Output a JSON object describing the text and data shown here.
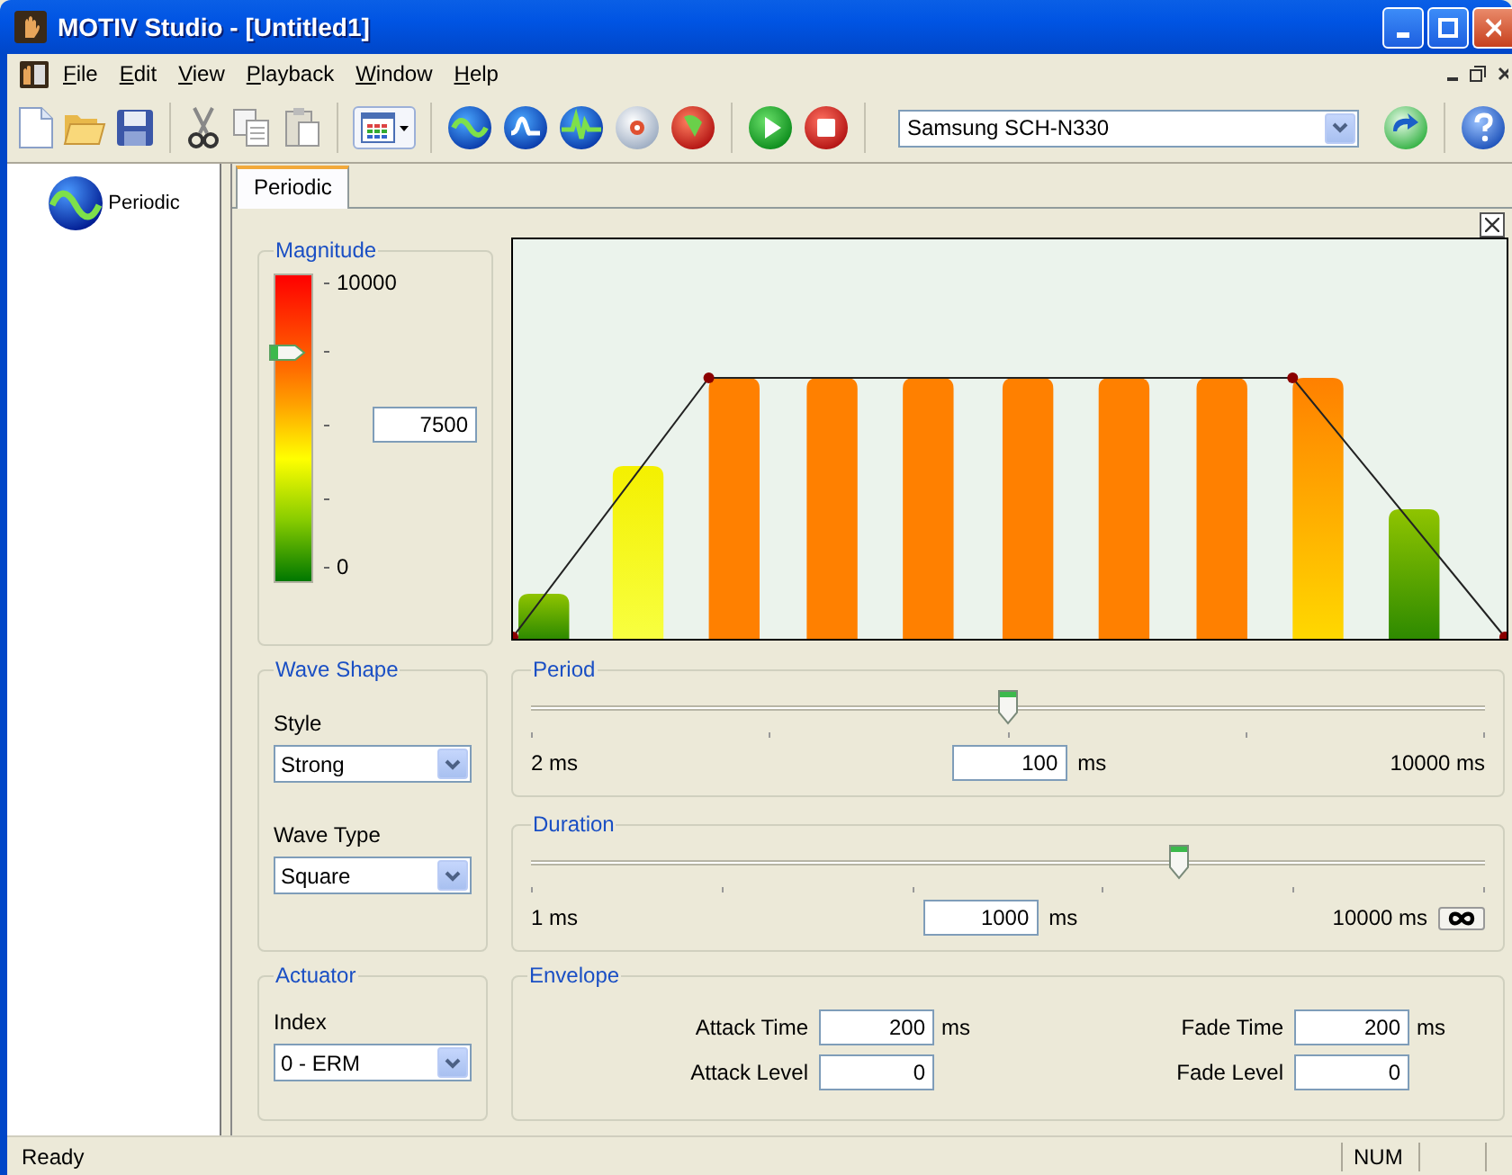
{
  "window": {
    "title": "MOTIV Studio - [Untitled1]"
  },
  "menu": [
    {
      "label": "File"
    },
    {
      "label": "Edit"
    },
    {
      "label": "View"
    },
    {
      "label": "Playback"
    },
    {
      "label": "Window"
    },
    {
      "label": "Help"
    }
  ],
  "toolbar": {
    "device": "Samsung SCH-N330"
  },
  "sidebar": {
    "items": [
      {
        "label": "Periodic"
      }
    ]
  },
  "tabs": [
    {
      "label": "Periodic",
      "selected": true
    }
  ],
  "magnitude": {
    "title": "Magnitude",
    "max_label": "10000",
    "min_label": "0",
    "level": 0.75,
    "value": "7500"
  },
  "wave_shape": {
    "title": "Wave Shape",
    "style_label": "Style",
    "style_value": "Strong",
    "type_label": "Wave Type",
    "type_value": "Square"
  },
  "actuator": {
    "title": "Actuator",
    "index_label": "Index",
    "index_value": "0 - ERM"
  },
  "period": {
    "title": "Period",
    "level": 0.5,
    "min_label": "2 ms",
    "value": "100",
    "unit": "ms",
    "max_label": "10000 ms",
    "infinite_button": false
  },
  "duration": {
    "title": "Duration",
    "level": 0.68,
    "min_label": "1 ms",
    "value": "1000",
    "unit": "ms",
    "max_label": "10000 ms",
    "infinite_button": true
  },
  "envelope": {
    "title": "Envelope",
    "fields": [
      {
        "label": "Attack Time",
        "value": "200",
        "unit": "ms"
      },
      {
        "label": "Fade Time",
        "value": "200",
        "unit": "ms"
      },
      {
        "label": "Attack Level",
        "value": "0"
      },
      {
        "label": "Fade Level",
        "value": "0"
      }
    ]
  },
  "status_bar": {
    "text": "Ready",
    "panels": [
      "NUM"
    ]
  }
}
